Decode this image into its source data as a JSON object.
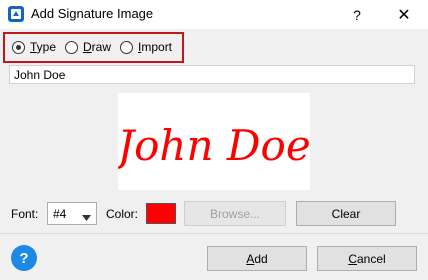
{
  "window": {
    "title": "Add Signature Image",
    "help_glyph": "?",
    "close_glyph": "✕"
  },
  "mode": {
    "options": [
      {
        "label": "Type",
        "selected": true
      },
      {
        "label": "Draw",
        "selected": false
      },
      {
        "label": "Import",
        "selected": false
      }
    ]
  },
  "name_input": {
    "value": "John Doe"
  },
  "preview": {
    "signature_text": "John Doe",
    "signature_color": "#ff0000"
  },
  "font": {
    "label": "Font:",
    "selected": "#4"
  },
  "color": {
    "label": "Color:",
    "value": "#ff0000"
  },
  "buttons": {
    "browse": "Browse...",
    "clear": "Clear",
    "add": "Add",
    "cancel": "Cancel"
  },
  "footer": {
    "help_glyph": "?"
  },
  "colors": {
    "highlight_border": "#c0161c",
    "help_blue": "#1e88e5",
    "dialog_bg": "#f0f0f0"
  }
}
